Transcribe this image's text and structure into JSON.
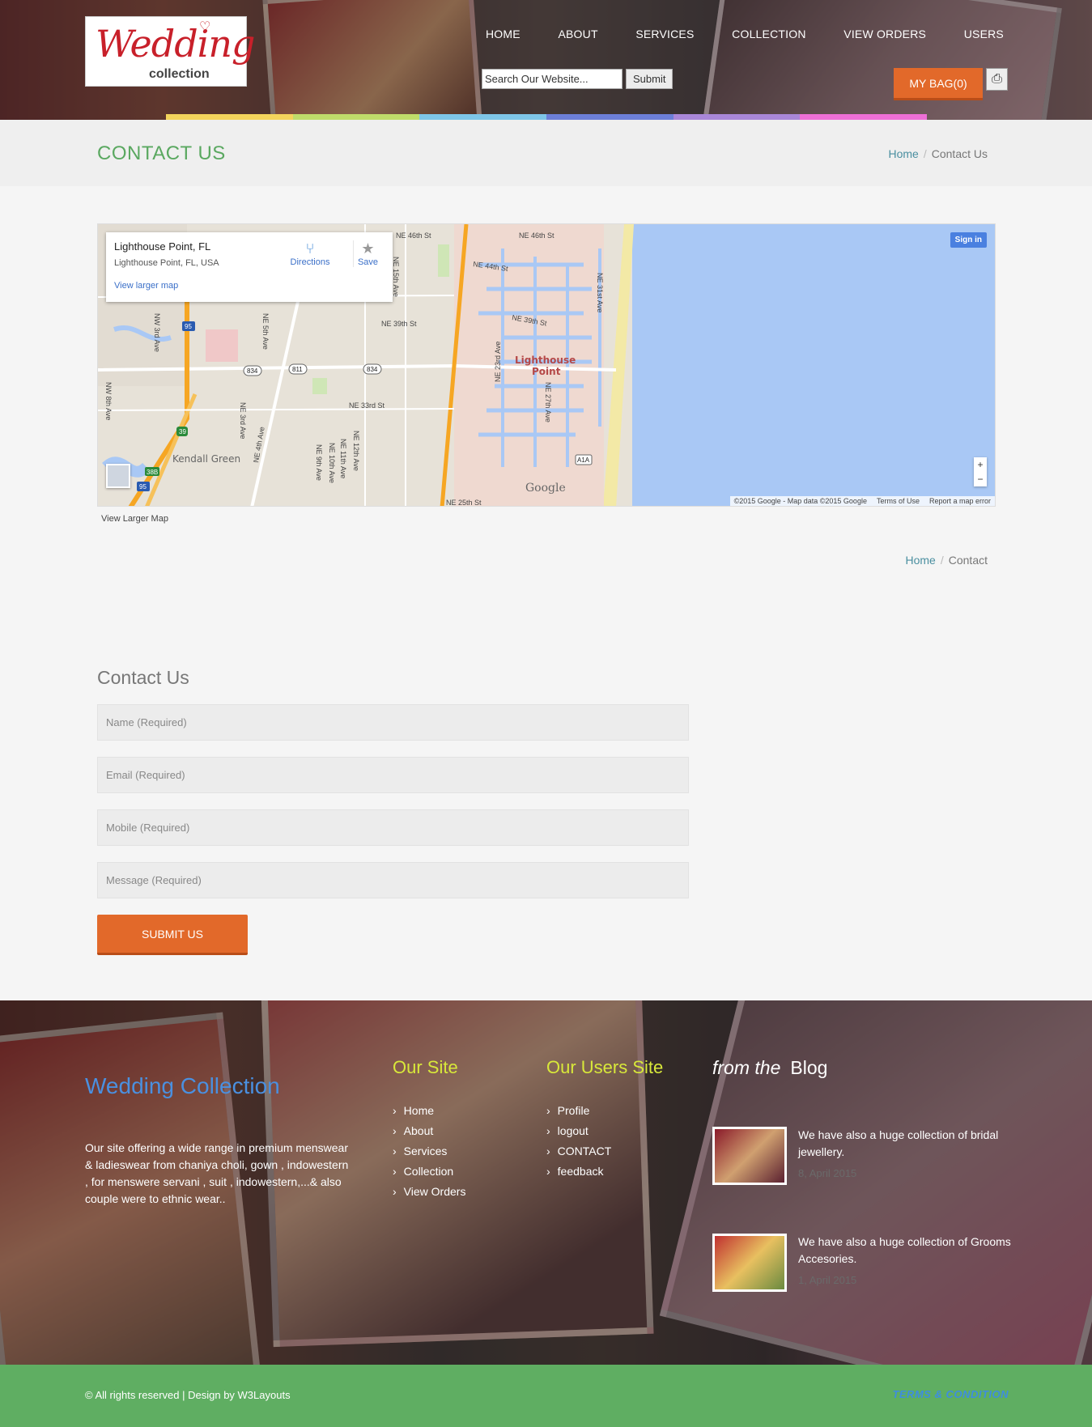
{
  "header": {
    "logo_main": "Wedding",
    "logo_sub": "collection",
    "nav": [
      "HOME",
      "ABOUT",
      "SERVICES",
      "COLLECTION",
      "VIEW ORDERS",
      "USERS"
    ],
    "search_value": "Search Our Website...",
    "search_button": "Submit",
    "bag_label": "MY BAG(0)",
    "print_icon": "printer-icon",
    "color_bar": [
      "#f3d45c",
      "#bfdc6a",
      "#7ec6e8",
      "#6c7fd8",
      "#a987d8",
      "#ee6fd6"
    ]
  },
  "title_strip": {
    "title": "CONTACT US",
    "breadcrumb": {
      "home": "Home",
      "current": "Contact Us"
    }
  },
  "map": {
    "place_name": "Lighthouse Point, FL",
    "place_address": "Lighthouse Point, FL, USA",
    "view_larger": "View larger map",
    "directions": "Directions",
    "save": "Save",
    "sign_in": "Sign in",
    "zoom_in": "+",
    "zoom_out": "−",
    "attribution": "©2015 Google - Map data ©2015 Google",
    "terms": "Terms of Use",
    "report": "Report a map error",
    "google": "Google",
    "city_label_1": "Lighthouse",
    "city_label_2": "Point",
    "district": "Kendall Green",
    "streets": [
      "NE 46th St",
      "NE 44th St",
      "NE 39th St",
      "NE 33rd St",
      "NE 25th St",
      "NE 31st Ave",
      "NE 27th Ave",
      "NE 23rd Ave",
      "NE 15th Ave",
      "NE 5th Ave",
      "NE 3rd Ave",
      "NW 3rd Ave",
      "NW 8th Ave",
      "NE 9th Ave",
      "NE 11th Ave",
      "NE 12th Ave",
      "NE 10th Ave",
      "NE 4th Ave"
    ],
    "shields": [
      "95",
      "834",
      "811",
      "834",
      "39",
      "38B",
      "95",
      "A1A"
    ],
    "below_map_link": "View Larger Map"
  },
  "breadcrumb2": {
    "home": "Home",
    "current": "Contact"
  },
  "contact_form": {
    "title": "Contact Us",
    "name_placeholder": "Name (Required)",
    "email_placeholder": "Email (Required)",
    "mobile_placeholder": "Mobile (Required)",
    "message_placeholder": "Message (Required)",
    "submit": "SUBMIT US"
  },
  "footer": {
    "brand": "Wedding Collection",
    "description": "Our site offering a wide range in premium menswear & ladieswear from chaniya choli, gown , indowestern , for menswere servani , suit , indowestern,...& also couple were to ethnic wear..",
    "our_site_heading": "Our Site",
    "our_site_links": [
      "Home",
      "About",
      "Services",
      "Collection",
      "View Orders"
    ],
    "users_heading": "Our Users Site",
    "users_links": [
      "Profile",
      "logout",
      "CONTACT",
      "feedback"
    ],
    "blog_heading_italic": "from the",
    "blog_heading": "Blog",
    "posts": [
      {
        "text": "We have also a huge collection of bridal jewellery.",
        "date": "8, April 2015"
      },
      {
        "text": "We have also a huge collection of Grooms Accesories.",
        "date": "1, April 2015"
      }
    ]
  },
  "bottom_bar": {
    "copyright": "© All rights reserved | Design by W3Layouts",
    "terms": "TERMS & CONDITION"
  }
}
